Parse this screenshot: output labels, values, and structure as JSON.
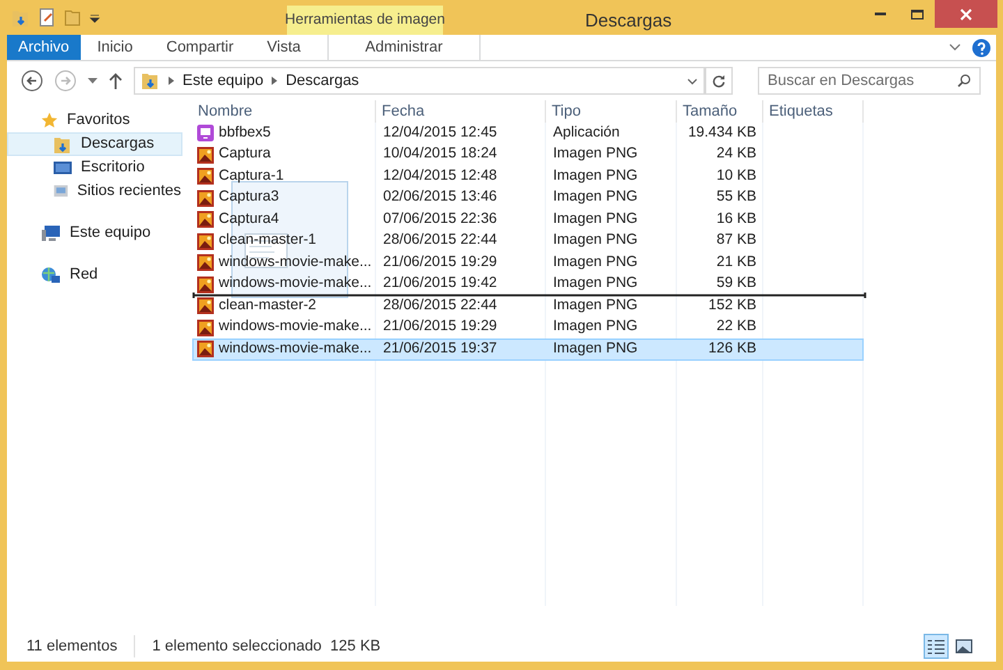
{
  "window": {
    "title": "Descargas",
    "contextual_label": "Herramientas de imagen"
  },
  "ribbon_tabs": [
    {
      "label": "Archivo",
      "kind": "file",
      "selected": false
    },
    {
      "label": "Inicio",
      "kind": "tab",
      "selected": false
    },
    {
      "label": "Compartir",
      "kind": "tab",
      "selected": false
    },
    {
      "label": "Vista",
      "kind": "tab",
      "selected": false
    },
    {
      "label": "Administrar",
      "kind": "contextual",
      "selected": false
    }
  ],
  "address": {
    "crumbs": [
      "Este equipo",
      "Descargas"
    ]
  },
  "search": {
    "placeholder": "Buscar en Descargas"
  },
  "nav_pane": [
    {
      "label": "Favoritos",
      "kind": "star",
      "selected": false,
      "children": [
        {
          "label": "Descargas",
          "kind": "downloads",
          "selected": true
        },
        {
          "label": "Escritorio",
          "kind": "desktop",
          "selected": false
        },
        {
          "label": "Sitios recientes",
          "kind": "recent",
          "selected": false
        }
      ]
    },
    {
      "label": "Este equipo",
      "kind": "computer",
      "selected": false
    },
    {
      "label": "Red",
      "kind": "network",
      "selected": false
    }
  ],
  "table": {
    "columns": [
      "Nombre",
      "Fecha",
      "Tipo",
      "Tamaño",
      "Etiquetas"
    ],
    "rows": [
      {
        "name": "bbfbex5",
        "date": "12/04/2015 12:45",
        "type": "Aplicación",
        "size": "19.434 KB",
        "kind": "app",
        "selected": false,
        "drop_line_after": false
      },
      {
        "name": "Captura",
        "date": "10/04/2015 18:24",
        "type": "Imagen PNG",
        "size": "24 KB",
        "kind": "image",
        "selected": false,
        "drop_line_after": false
      },
      {
        "name": "Captura-1",
        "date": "12/04/2015 12:48",
        "type": "Imagen PNG",
        "size": "10 KB",
        "kind": "image",
        "selected": false,
        "drop_line_after": false
      },
      {
        "name": "Captura3",
        "date": "02/06/2015 13:46",
        "type": "Imagen PNG",
        "size": "55 KB",
        "kind": "image",
        "selected": false,
        "drop_line_after": false
      },
      {
        "name": "Captura4",
        "date": "07/06/2015 22:36",
        "type": "Imagen PNG",
        "size": "16 KB",
        "kind": "image",
        "selected": false,
        "drop_line_after": false
      },
      {
        "name": "clean-master-1",
        "date": "28/06/2015 22:44",
        "type": "Imagen PNG",
        "size": "87 KB",
        "kind": "image",
        "selected": false,
        "drop_line_after": false
      },
      {
        "name": "windows-movie-make...",
        "date": "21/06/2015 19:29",
        "type": "Imagen PNG",
        "size": "21 KB",
        "kind": "image",
        "selected": false,
        "drop_line_after": false
      },
      {
        "name": "windows-movie-make...",
        "date": "21/06/2015 19:42",
        "type": "Imagen PNG",
        "size": "59 KB",
        "kind": "image",
        "selected": false,
        "drop_line_after": true
      },
      {
        "name": "clean-master-2",
        "date": "28/06/2015 22:44",
        "type": "Imagen PNG",
        "size": "152 KB",
        "kind": "image",
        "selected": false,
        "drop_line_after": false
      },
      {
        "name": "windows-movie-make...",
        "date": "21/06/2015 19:29",
        "type": "Imagen PNG",
        "size": "22 KB",
        "kind": "image",
        "selected": false,
        "drop_line_after": false
      },
      {
        "name": "windows-movie-make...",
        "date": "21/06/2015 19:37",
        "type": "Imagen PNG",
        "size": "126 KB",
        "kind": "image",
        "selected": true,
        "drop_line_after": false
      }
    ]
  },
  "status_bar": {
    "count": "11 elementos",
    "selection": "1 elemento seleccionado  125 KB"
  },
  "view_buttons": [
    {
      "kind": "details",
      "selected": true
    },
    {
      "kind": "thumbnails",
      "selected": false
    }
  ]
}
